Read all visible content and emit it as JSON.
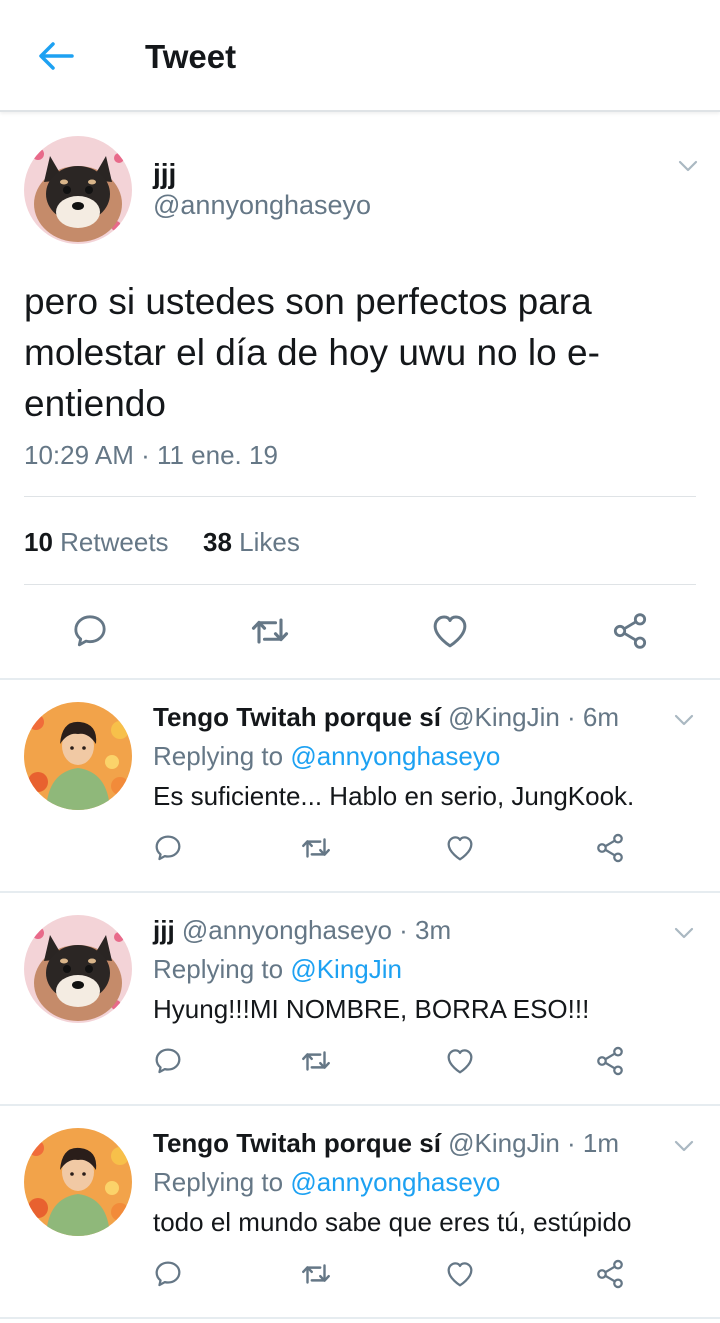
{
  "header": {
    "title": "Tweet"
  },
  "tweet": {
    "name": "jjj",
    "handle": "@annyonghaseyo",
    "text": "pero si ustedes son perfectos para molestar el día de hoy uwu no lo e-entiendo",
    "timestamp": "10:29 AM · 11 ene. 19",
    "retweets_count": "10",
    "retweets_label": "Retweets",
    "likes_count": "38",
    "likes_label": "Likes"
  },
  "replies": [
    {
      "name": "Tengo Twitah porque sí",
      "meta": "@KingJin · 6m",
      "replying_label": "Replying to",
      "replying_to": "@annyonghaseyo",
      "text": "Es suficiente... Hablo en serio, JungKook.",
      "avatar": "jin"
    },
    {
      "name": "jjj",
      "meta": "@annyonghaseyo · 3m",
      "replying_label": "Replying to",
      "replying_to": "@KingJin",
      "text": "Hyung!!!MI NOMBRE, BORRA ESO!!!",
      "avatar": "dog"
    },
    {
      "name": "Tengo Twitah porque sí",
      "meta": "@KingJin · 1m",
      "replying_label": "Replying to",
      "replying_to": "@annyonghaseyo",
      "text": "todo el mundo sabe que eres tú, estúpido",
      "avatar": "jin"
    }
  ],
  "icons": {
    "back": "arrow-left-icon",
    "chevron": "chevron-down-icon",
    "reply": "reply-icon",
    "retweet": "retweet-icon",
    "like": "heart-icon",
    "share": "share-icon"
  },
  "colors": {
    "accent": "#1da1f2",
    "text": "#14171a",
    "secondary": "#657786",
    "icon": "#657786"
  }
}
